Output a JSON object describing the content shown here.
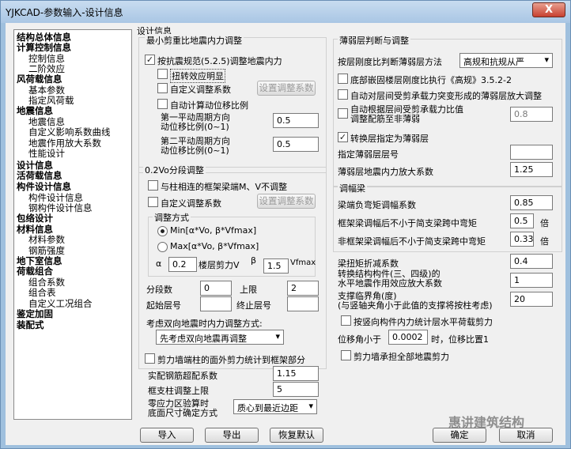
{
  "window": {
    "title": "YJKCAD-参数输入-设计信息",
    "close": "X"
  },
  "tree": [
    {
      "label": "结构总体信息",
      "bold": true
    },
    {
      "label": "计算控制信息",
      "bold": true
    },
    {
      "label": "控制信息",
      "bold": false
    },
    {
      "label": "二阶效应",
      "bold": false
    },
    {
      "label": "风荷载信息",
      "bold": true
    },
    {
      "label": "基本参数",
      "bold": false
    },
    {
      "label": "指定风荷载",
      "bold": false
    },
    {
      "label": "地震信息",
      "bold": true
    },
    {
      "label": "地震信息",
      "bold": false
    },
    {
      "label": "自定义影响系数曲线",
      "bold": false
    },
    {
      "label": "地震作用放大系数",
      "bold": false
    },
    {
      "label": "性能设计",
      "bold": false
    },
    {
      "label": "设计信息",
      "bold": true
    },
    {
      "label": "活荷载信息",
      "bold": true
    },
    {
      "label": "构件设计信息",
      "bold": true
    },
    {
      "label": "构件设计信息",
      "bold": false
    },
    {
      "label": "钢构件设计信息",
      "bold": false
    },
    {
      "label": "包络设计",
      "bold": true
    },
    {
      "label": "材料信息",
      "bold": true
    },
    {
      "label": "材料参数",
      "bold": false
    },
    {
      "label": "钢筋强度",
      "bold": false
    },
    {
      "label": "地下室信息",
      "bold": true
    },
    {
      "label": "荷载组合",
      "bold": true
    },
    {
      "label": "组合系数",
      "bold": false
    },
    {
      "label": "组合表",
      "bold": false
    },
    {
      "label": "自定义工况组合",
      "bold": false
    },
    {
      "label": "鉴定加固",
      "bold": true
    },
    {
      "label": "装配式",
      "bold": true
    }
  ],
  "left": {
    "section_title": "设计信息",
    "min_shear_group": "最小剪重比地震内力调整",
    "adjust_by_code": {
      "label": "按抗震规范(5.2.5)调整地震内力",
      "checked": true
    },
    "torsion": {
      "label": "扭转效应明显",
      "checked": false
    },
    "custom_coef": {
      "label": "自定义调整系数",
      "checked": false
    },
    "set_coef_btn": "设置调整系数",
    "auto_disp": {
      "label": "自动计算动位移比例",
      "checked": false
    },
    "period1_label": "第一平动周期方向\n动位移比例(0~1)",
    "period1_value": "0.5",
    "period2_label": "第二平动周期方向\n动位移比例(0~1)",
    "period2_value": "0.5",
    "v0_group": "0.2Vo分段调整",
    "frame_beam": {
      "label": "与柱相连的框架梁端M、V不调整",
      "checked": false
    },
    "custom_coef2": {
      "label": "自定义调整系数",
      "checked": false
    },
    "set_coef_btn2": "设置调整系数",
    "adjust_method_group": "调整方式",
    "radio_min": {
      "label": "Min[α*Vo, β*Vfmax]",
      "checked": true
    },
    "radio_max": {
      "label": "Max[α*Vo, β*Vfmax]",
      "checked": false
    },
    "alpha_label": "α",
    "alpha_value": "0.2",
    "floor_shear_label": "楼层剪力V",
    "beta_label": "β",
    "beta_value": "1.5",
    "vfmax_label": "Vfmax",
    "segments_label": "分段数",
    "segments_value": "0",
    "upper_label": "上限",
    "upper_value": "2",
    "start_floor_label": "起始层号",
    "start_floor_value": "",
    "end_floor_label": "终止层号",
    "end_floor_value": "",
    "bidir_label": "考虑双向地震时内力调整方式:",
    "bidir_value": "先考虑双向地震再调整",
    "wall_col": {
      "label": "剪力墙端柱的面外剪力统计到框架部分",
      "checked": false
    },
    "rebar_ratio_label": "实配钢筋超配系数",
    "rebar_ratio_value": "1.15",
    "beam_support_label": "框支柱调整上限",
    "beam_support_value": "5",
    "zero_stress_label": "零应力区验算时\n底面尺寸确定方式",
    "zero_stress_value": "质心到最近边距"
  },
  "right": {
    "weak_group": "薄弱层判断与调整",
    "weak_method_label": "按层刚度比判断薄弱层方法",
    "weak_method_value": "高规和抗规从严",
    "base_stiff": {
      "label": "底部嵌固楼层刚度比执行《高规》3.5.2-2",
      "checked": false
    },
    "auto_shear": {
      "label": "自动对层间受剪承载力突变形成的薄弱层放大调整",
      "checked": false
    },
    "auto_ratio": {
      "label": "自动根据层间受剪承载力比值\n调整配筋至非薄弱",
      "checked": false
    },
    "auto_ratio_value": "0.8",
    "transfer": {
      "label": "转换层指定为薄弱层",
      "checked": true
    },
    "weak_floor_label": "指定薄弱层层号",
    "weak_floor_value": "",
    "weak_amp_label": "薄弱层地震内力放大系数",
    "weak_amp_value": "1.25",
    "amp_group": "调幅梁",
    "beam_neg_label": "梁端负弯矩调幅系数",
    "beam_neg_value": "0.85",
    "frame_beam_label": "框架梁调幅后不小于简支梁跨中弯矩",
    "frame_beam_value": "0.5",
    "times1": "倍",
    "nonframe_label": "非框架梁调幅后不小于简支梁跨中弯矩",
    "nonframe_value": "0.33",
    "times2": "倍",
    "torsion_red_label": "梁扭矩折减系数",
    "torsion_red_value": "0.4",
    "transfer_amp_label": "转换结构构件(三、四级)的\n水平地震作用效应放大系数",
    "transfer_amp_value": "1",
    "brace_label": "支撑临界角(度)\n(与竖轴夹角小于此值的支撑将按柱考虑)",
    "brace_value": "20",
    "vertical": {
      "label": "按竖向构件内力统计层水平荷载剪力",
      "checked": false
    },
    "disp_label": "位移角小于",
    "disp_value": "0.0002",
    "disp_suffix": "时，位移比置1",
    "wall_shear": {
      "label": "剪力墙承担全部地震剪力",
      "checked": false
    }
  },
  "footer": {
    "import": "导入",
    "export": "导出",
    "restore": "恢复默认",
    "ok": "确定",
    "cancel": "取消",
    "watermark": "惠讲建筑结构"
  }
}
